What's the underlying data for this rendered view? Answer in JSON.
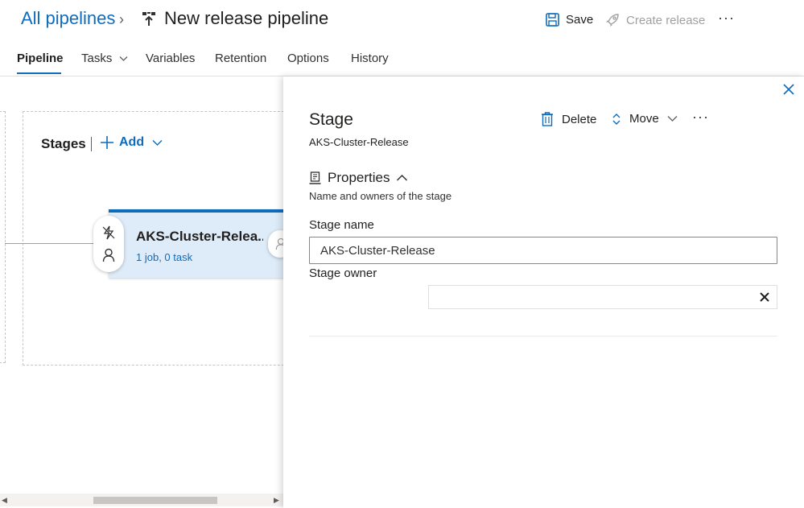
{
  "header": {
    "breadcrumb": "All pipelines",
    "title": "New release pipeline",
    "save_label": "Save",
    "create_release_label": "Create release",
    "more": "···"
  },
  "tabs": [
    {
      "label": "Pipeline",
      "active": true
    },
    {
      "label": "Tasks"
    },
    {
      "label": "Variables"
    },
    {
      "label": "Retention"
    },
    {
      "label": "Options"
    },
    {
      "label": "History"
    }
  ],
  "canvas": {
    "stages_label": "Stages",
    "add_label": "Add",
    "stage_card": {
      "name": "AKS-Cluster-Relea...",
      "summary": "1 job, 0 task"
    }
  },
  "panel": {
    "title": "Stage",
    "subtitle": "AKS-Cluster-Release",
    "delete_label": "Delete",
    "move_label": "Move",
    "more": "···",
    "properties_heading": "Properties",
    "properties_desc": "Name and owners of the stage",
    "stage_name_label": "Stage name",
    "stage_name_value": "AKS-Cluster-Release",
    "stage_owner_label": "Stage owner"
  },
  "colors": {
    "accent": "#0f6cbd",
    "card_bg": "#deecf9",
    "disabled": "#a19f9d"
  }
}
